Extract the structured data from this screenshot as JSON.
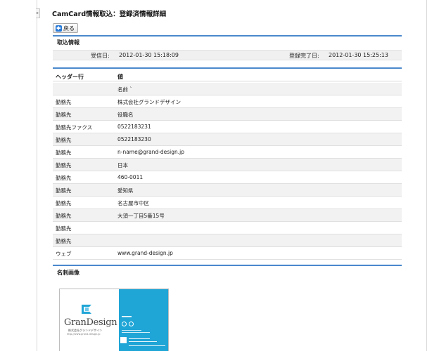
{
  "page": {
    "title": "CamCard情報取込：登録済情報詳細",
    "back_label": "戻る"
  },
  "receipt": {
    "section_title": "取込情報",
    "received_label": "受信日:",
    "received_value": "2012-01-30 15:18:09",
    "registered_label": "登録完了日:",
    "registered_value": "2012-01-30 15:25:13"
  },
  "table": {
    "col_header": "ヘッダー行",
    "col_value": "値",
    "rows": [
      {
        "key": "",
        "value": "名前 `"
      },
      {
        "key": "勤務先",
        "value": "株式会社グランドデザイン"
      },
      {
        "key": "勤務先",
        "value": "役職名"
      },
      {
        "key": "勤務先ファクス",
        "value": "0522183231"
      },
      {
        "key": "勤務先",
        "value": "0522183230"
      },
      {
        "key": "勤務先",
        "value": "n-name@grand-design.jp"
      },
      {
        "key": "勤務先",
        "value": "日本"
      },
      {
        "key": "勤務先",
        "value": "460-0011"
      },
      {
        "key": "勤務先",
        "value": "愛知県"
      },
      {
        "key": "勤務先",
        "value": "名古屋市中区"
      },
      {
        "key": "勤務先",
        "value": "大須一丁目5番15号"
      },
      {
        "key": "勤務先",
        "value": ""
      },
      {
        "key": "勤務先",
        "value": ""
      },
      {
        "key": "ウェブ",
        "value": "www.grand-design.jp"
      }
    ]
  },
  "card_section": {
    "title": "名刺画像",
    "brand": "GranDesign",
    "brand_sub": "株式会社グランドデザイン",
    "brand_url": "http://www.grand-design.jp"
  },
  "colors": {
    "accent": "#4a88cc",
    "card_blue": "#1fa5d6"
  },
  "icons": {
    "back": "arrow-left-icon",
    "side_toggle": "chevron-right-icon"
  }
}
